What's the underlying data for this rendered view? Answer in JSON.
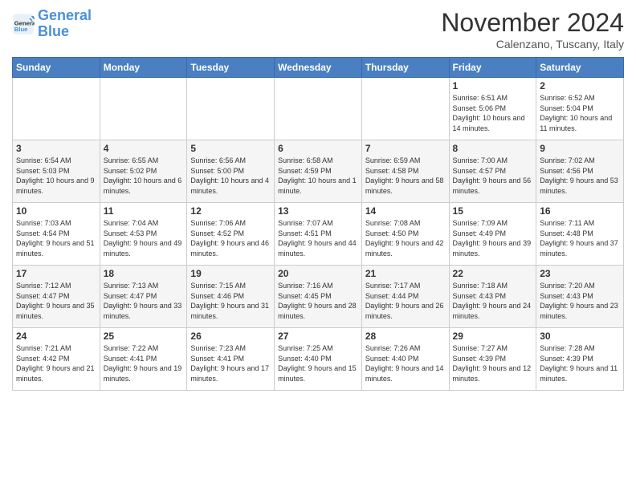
{
  "header": {
    "logo_line1": "General",
    "logo_line2": "Blue",
    "month": "November 2024",
    "location": "Calenzano, Tuscany, Italy"
  },
  "days_of_week": [
    "Sunday",
    "Monday",
    "Tuesday",
    "Wednesday",
    "Thursday",
    "Friday",
    "Saturday"
  ],
  "weeks": [
    [
      {
        "day": "",
        "info": ""
      },
      {
        "day": "",
        "info": ""
      },
      {
        "day": "",
        "info": ""
      },
      {
        "day": "",
        "info": ""
      },
      {
        "day": "",
        "info": ""
      },
      {
        "day": "1",
        "info": "Sunrise: 6:51 AM\nSunset: 5:06 PM\nDaylight: 10 hours and 14 minutes."
      },
      {
        "day": "2",
        "info": "Sunrise: 6:52 AM\nSunset: 5:04 PM\nDaylight: 10 hours and 11 minutes."
      }
    ],
    [
      {
        "day": "3",
        "info": "Sunrise: 6:54 AM\nSunset: 5:03 PM\nDaylight: 10 hours and 9 minutes."
      },
      {
        "day": "4",
        "info": "Sunrise: 6:55 AM\nSunset: 5:02 PM\nDaylight: 10 hours and 6 minutes."
      },
      {
        "day": "5",
        "info": "Sunrise: 6:56 AM\nSunset: 5:00 PM\nDaylight: 10 hours and 4 minutes."
      },
      {
        "day": "6",
        "info": "Sunrise: 6:58 AM\nSunset: 4:59 PM\nDaylight: 10 hours and 1 minute."
      },
      {
        "day": "7",
        "info": "Sunrise: 6:59 AM\nSunset: 4:58 PM\nDaylight: 9 hours and 58 minutes."
      },
      {
        "day": "8",
        "info": "Sunrise: 7:00 AM\nSunset: 4:57 PM\nDaylight: 9 hours and 56 minutes."
      },
      {
        "day": "9",
        "info": "Sunrise: 7:02 AM\nSunset: 4:56 PM\nDaylight: 9 hours and 53 minutes."
      }
    ],
    [
      {
        "day": "10",
        "info": "Sunrise: 7:03 AM\nSunset: 4:54 PM\nDaylight: 9 hours and 51 minutes."
      },
      {
        "day": "11",
        "info": "Sunrise: 7:04 AM\nSunset: 4:53 PM\nDaylight: 9 hours and 49 minutes."
      },
      {
        "day": "12",
        "info": "Sunrise: 7:06 AM\nSunset: 4:52 PM\nDaylight: 9 hours and 46 minutes."
      },
      {
        "day": "13",
        "info": "Sunrise: 7:07 AM\nSunset: 4:51 PM\nDaylight: 9 hours and 44 minutes."
      },
      {
        "day": "14",
        "info": "Sunrise: 7:08 AM\nSunset: 4:50 PM\nDaylight: 9 hours and 42 minutes."
      },
      {
        "day": "15",
        "info": "Sunrise: 7:09 AM\nSunset: 4:49 PM\nDaylight: 9 hours and 39 minutes."
      },
      {
        "day": "16",
        "info": "Sunrise: 7:11 AM\nSunset: 4:48 PM\nDaylight: 9 hours and 37 minutes."
      }
    ],
    [
      {
        "day": "17",
        "info": "Sunrise: 7:12 AM\nSunset: 4:47 PM\nDaylight: 9 hours and 35 minutes."
      },
      {
        "day": "18",
        "info": "Sunrise: 7:13 AM\nSunset: 4:47 PM\nDaylight: 9 hours and 33 minutes."
      },
      {
        "day": "19",
        "info": "Sunrise: 7:15 AM\nSunset: 4:46 PM\nDaylight: 9 hours and 31 minutes."
      },
      {
        "day": "20",
        "info": "Sunrise: 7:16 AM\nSunset: 4:45 PM\nDaylight: 9 hours and 28 minutes."
      },
      {
        "day": "21",
        "info": "Sunrise: 7:17 AM\nSunset: 4:44 PM\nDaylight: 9 hours and 26 minutes."
      },
      {
        "day": "22",
        "info": "Sunrise: 7:18 AM\nSunset: 4:43 PM\nDaylight: 9 hours and 24 minutes."
      },
      {
        "day": "23",
        "info": "Sunrise: 7:20 AM\nSunset: 4:43 PM\nDaylight: 9 hours and 23 minutes."
      }
    ],
    [
      {
        "day": "24",
        "info": "Sunrise: 7:21 AM\nSunset: 4:42 PM\nDaylight: 9 hours and 21 minutes."
      },
      {
        "day": "25",
        "info": "Sunrise: 7:22 AM\nSunset: 4:41 PM\nDaylight: 9 hours and 19 minutes."
      },
      {
        "day": "26",
        "info": "Sunrise: 7:23 AM\nSunset: 4:41 PM\nDaylight: 9 hours and 17 minutes."
      },
      {
        "day": "27",
        "info": "Sunrise: 7:25 AM\nSunset: 4:40 PM\nDaylight: 9 hours and 15 minutes."
      },
      {
        "day": "28",
        "info": "Sunrise: 7:26 AM\nSunset: 4:40 PM\nDaylight: 9 hours and 14 minutes."
      },
      {
        "day": "29",
        "info": "Sunrise: 7:27 AM\nSunset: 4:39 PM\nDaylight: 9 hours and 12 minutes."
      },
      {
        "day": "30",
        "info": "Sunrise: 7:28 AM\nSunset: 4:39 PM\nDaylight: 9 hours and 11 minutes."
      }
    ]
  ]
}
